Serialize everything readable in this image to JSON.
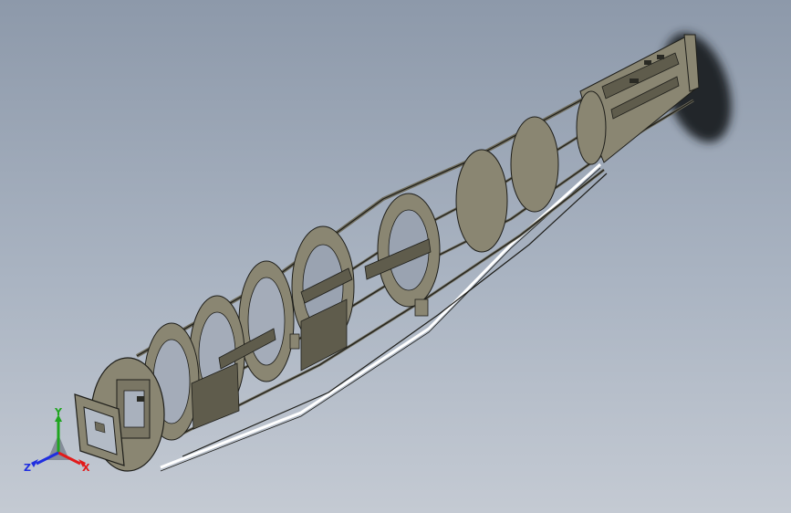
{
  "viewport": {
    "background_top": "#8d99aa",
    "background_bottom": "#c4cad3"
  },
  "model": {
    "part_color": "#8a8672",
    "part_shade": "#5f5c4c",
    "edge_color": "#1e1e1a",
    "shadow_color": "#23262b"
  },
  "triad": {
    "labels": {
      "x": "X",
      "y": "Y",
      "z": "Z"
    },
    "colors": {
      "x": "#e21a1a",
      "y": "#1fa51f",
      "z": "#1f2ee0"
    }
  }
}
